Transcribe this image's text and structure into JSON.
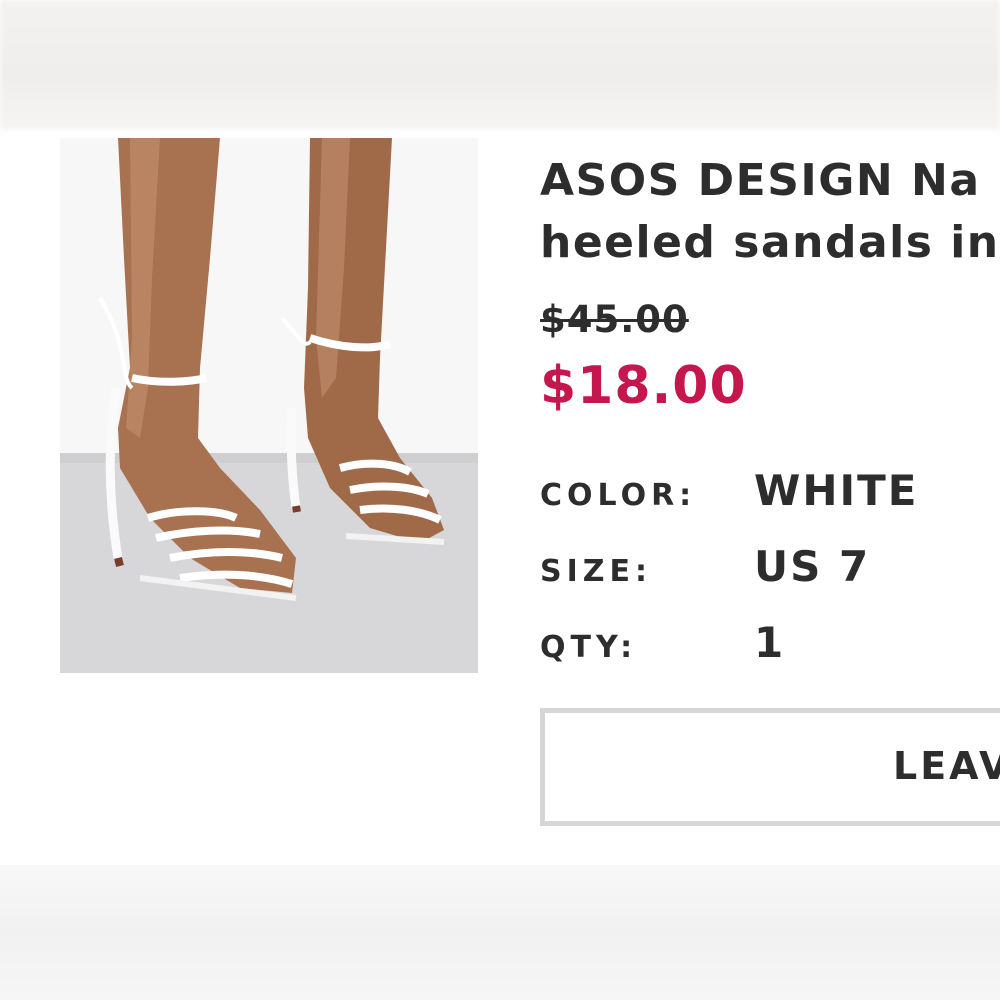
{
  "product": {
    "title_line1": "ASOS DESIGN Na",
    "title_line2": "heeled sandals in",
    "price_original": "$45.00",
    "price_sale": "$18.00",
    "image_alt": "White strappy heeled sandals"
  },
  "attributes": {
    "color_label": "COLOR:",
    "color_value": "WHITE",
    "size_label": "SIZE:",
    "size_value": "US 7",
    "qty_label": "QTY:",
    "qty_value": "1"
  },
  "actions": {
    "leave_label": "LEAV"
  },
  "colors": {
    "text": "#2d2d2d",
    "sale_price": "#c6164e",
    "button_border": "#d6d6d6",
    "background": "#ffffff"
  }
}
